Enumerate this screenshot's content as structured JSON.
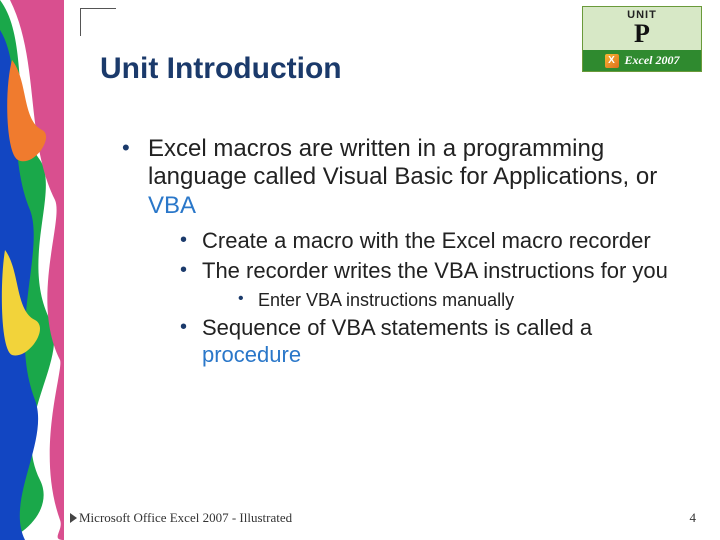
{
  "badge": {
    "unit_label": "UNIT",
    "unit_letter": "P",
    "product": "Excel 2007"
  },
  "title": "Unit Introduction",
  "bullets": {
    "b1_pre": "Excel macros are written in a programming language called Visual Basic for Applications, or ",
    "b1_hl": "VBA",
    "b2": "Create a macro with the Excel macro recorder",
    "b3": "The recorder writes the VBA instructions for you",
    "b4": "Enter VBA instructions manually",
    "b5_pre": "Sequence of VBA statements is called a ",
    "b5_hl": "procedure"
  },
  "footer_left": "Microsoft Office Excel 2007 - Illustrated",
  "footer_right": "4"
}
